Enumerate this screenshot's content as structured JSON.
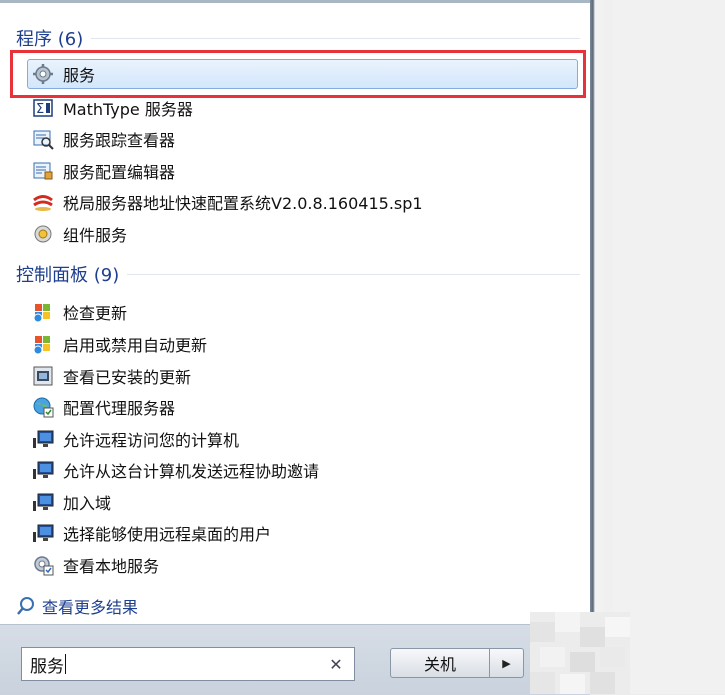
{
  "programs": {
    "header": "程序 (6)",
    "items": [
      {
        "label": "服务",
        "icon": "gear-icon"
      },
      {
        "label": "MathType 服务器",
        "icon": "mathtype-icon"
      },
      {
        "label": "服务跟踪查看器",
        "icon": "trace-viewer-icon"
      },
      {
        "label": "服务配置编辑器",
        "icon": "config-editor-icon"
      },
      {
        "label": "税局服务器地址快速配置系统V2.0.8.160415.sp1",
        "icon": "tax-config-icon"
      },
      {
        "label": "组件服务",
        "icon": "component-services-icon"
      }
    ]
  },
  "control_panel": {
    "header": "控制面板 (9)",
    "items": [
      {
        "label": "检查更新",
        "icon": "windows-update-icon"
      },
      {
        "label": "启用或禁用自动更新",
        "icon": "windows-update-icon"
      },
      {
        "label": "查看已安装的更新",
        "icon": "installed-updates-icon"
      },
      {
        "label": "配置代理服务器",
        "icon": "internet-options-icon"
      },
      {
        "label": "允许远程访问您的计算机",
        "icon": "remote-computer-icon"
      },
      {
        "label": "允许从这台计算机发送远程协助邀请",
        "icon": "remote-computer-icon"
      },
      {
        "label": "加入域",
        "icon": "remote-computer-icon"
      },
      {
        "label": "选择能够使用远程桌面的用户",
        "icon": "remote-computer-icon"
      },
      {
        "label": "查看本地服务",
        "icon": "local-services-icon"
      }
    ]
  },
  "more_results": "查看更多结果",
  "search": {
    "value": "服务"
  },
  "shutdown": {
    "label": "关机"
  },
  "colors": {
    "header": "#1e3f8f",
    "highlight": "#e8323a",
    "selected_border": "#84acdd"
  }
}
